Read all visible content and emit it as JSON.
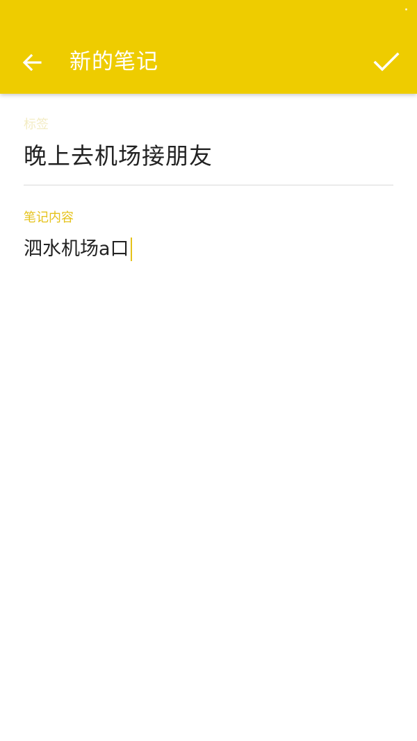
{
  "app_bar": {
    "title": "新的笔记",
    "back_icon": "arrow-left-icon",
    "done_icon": "check-icon",
    "background_color": "#eecc00"
  },
  "form": {
    "tag": {
      "label": "标签",
      "value": "晚上去机场接朋友"
    },
    "content": {
      "label": "笔记内容",
      "value": "泗水机场a口"
    }
  },
  "colors": {
    "accent": "#e5c21a",
    "text": "#222222"
  }
}
